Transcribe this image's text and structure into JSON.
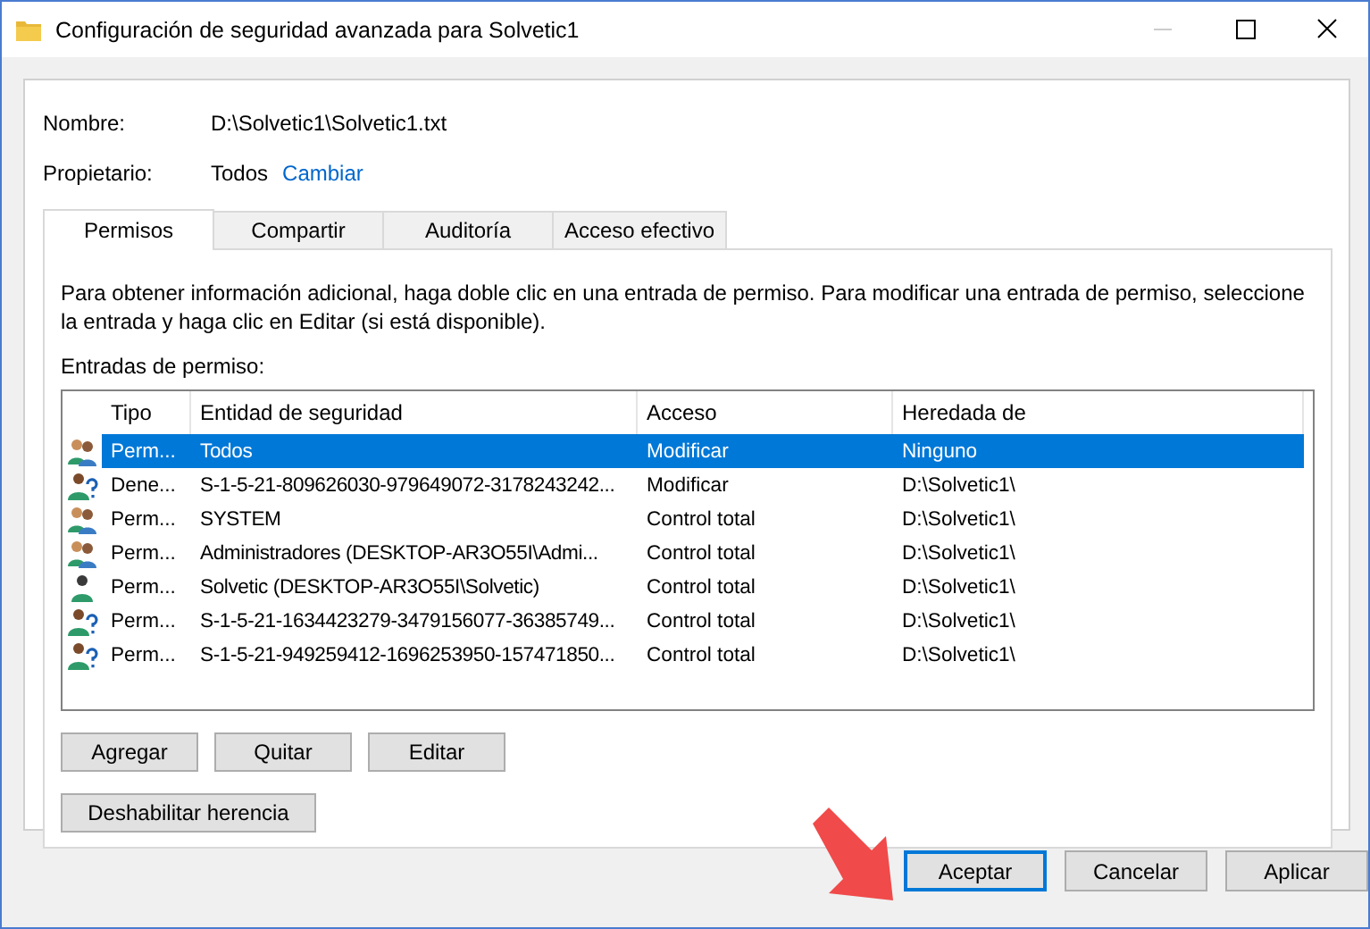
{
  "window": {
    "title": "Configuración de seguridad avanzada para Solvetic1"
  },
  "fields": [
    {
      "label": "Nombre:",
      "value": "D:\\Solvetic1\\Solvetic1.txt"
    },
    {
      "label": "Propietario:",
      "value": "Todos",
      "link": "Cambiar"
    }
  ],
  "tabs": [
    {
      "label": "Permisos",
      "selected": true
    },
    {
      "label": "Compartir",
      "selected": false
    },
    {
      "label": "Auditoría",
      "selected": false
    },
    {
      "label": "Acceso efectivo",
      "selected": false
    }
  ],
  "description": "Para obtener información adicional, haga doble clic en una entrada de permiso. Para modificar una entrada de permiso, seleccione la entrada y haga clic en Editar (si está disponible).",
  "entries_label": "Entradas de permiso:",
  "table": {
    "columns": [
      "Tipo",
      "Entidad de seguridad",
      "Acceso",
      "Heredada de"
    ],
    "rows": [
      {
        "kind": "group",
        "selected": true,
        "cells": [
          "Perm...",
          "Todos",
          "Modificar",
          "Ninguno"
        ]
      },
      {
        "kind": "unknown",
        "selected": false,
        "cells": [
          "Dene...",
          "S-1-5-21-809626030-979649072-3178243242...",
          "Modificar",
          "D:\\Solvetic1\\"
        ]
      },
      {
        "kind": "group",
        "selected": false,
        "cells": [
          "Perm...",
          "SYSTEM",
          "Control total",
          "D:\\Solvetic1\\"
        ]
      },
      {
        "kind": "group",
        "selected": false,
        "cells": [
          "Perm...",
          "Administradores (DESKTOP-AR3O55I\\Admi...",
          "Control total",
          "D:\\Solvetic1\\"
        ]
      },
      {
        "kind": "user",
        "selected": false,
        "cells": [
          "Perm...",
          "Solvetic (DESKTOP-AR3O55I\\Solvetic)",
          "Control total",
          "D:\\Solvetic1\\"
        ]
      },
      {
        "kind": "unknown",
        "selected": false,
        "cells": [
          "Perm...",
          "S-1-5-21-1634423279-3479156077-36385749...",
          "Control total",
          "D:\\Solvetic1\\"
        ]
      },
      {
        "kind": "unknown",
        "selected": false,
        "cells": [
          "Perm...",
          "S-1-5-21-949259412-1696253950-157471850...",
          "Control total",
          "D:\\Solvetic1\\"
        ]
      }
    ]
  },
  "entry_buttons": [
    "Agregar",
    "Quitar",
    "Editar"
  ],
  "inheritance_button": "Deshabilitar herencia",
  "dialog_buttons": [
    {
      "label": "Aceptar",
      "default": true
    },
    {
      "label": "Cancelar",
      "default": false
    },
    {
      "label": "Aplicar",
      "default": false
    }
  ]
}
